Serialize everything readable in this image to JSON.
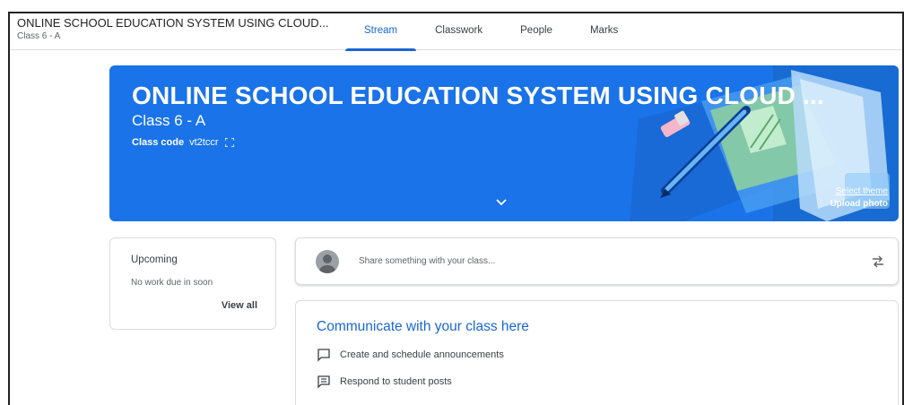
{
  "header": {
    "course_title": "ONLINE SCHOOL EDUCATION SYSTEM USING CLOUD...",
    "course_section": "Class 6 - A",
    "tabs": [
      {
        "label": "Stream",
        "active": true
      },
      {
        "label": "Classwork",
        "active": false
      },
      {
        "label": "People",
        "active": false
      },
      {
        "label": "Marks",
        "active": false
      }
    ]
  },
  "banner": {
    "title": "ONLINE SCHOOL EDUCATION SYSTEM USING CLOUD ...",
    "section": "Class 6 - A",
    "class_code_label": "Class code",
    "class_code": "vt2tccr",
    "select_theme": "Select theme",
    "upload_photo": "Upload photo",
    "color": "#1a73e8"
  },
  "upcoming": {
    "title": "Upcoming",
    "message": "No work due in soon",
    "view_all": "View all"
  },
  "share": {
    "placeholder": "Share something with your class..."
  },
  "communicate": {
    "title": "Communicate with your class here",
    "items": [
      {
        "icon": "announcement-icon",
        "label": "Create and schedule announcements"
      },
      {
        "icon": "student-post-icon",
        "label": "Respond to student posts"
      }
    ]
  },
  "colors": {
    "accent": "#1967d2",
    "border": "#dadce0"
  }
}
